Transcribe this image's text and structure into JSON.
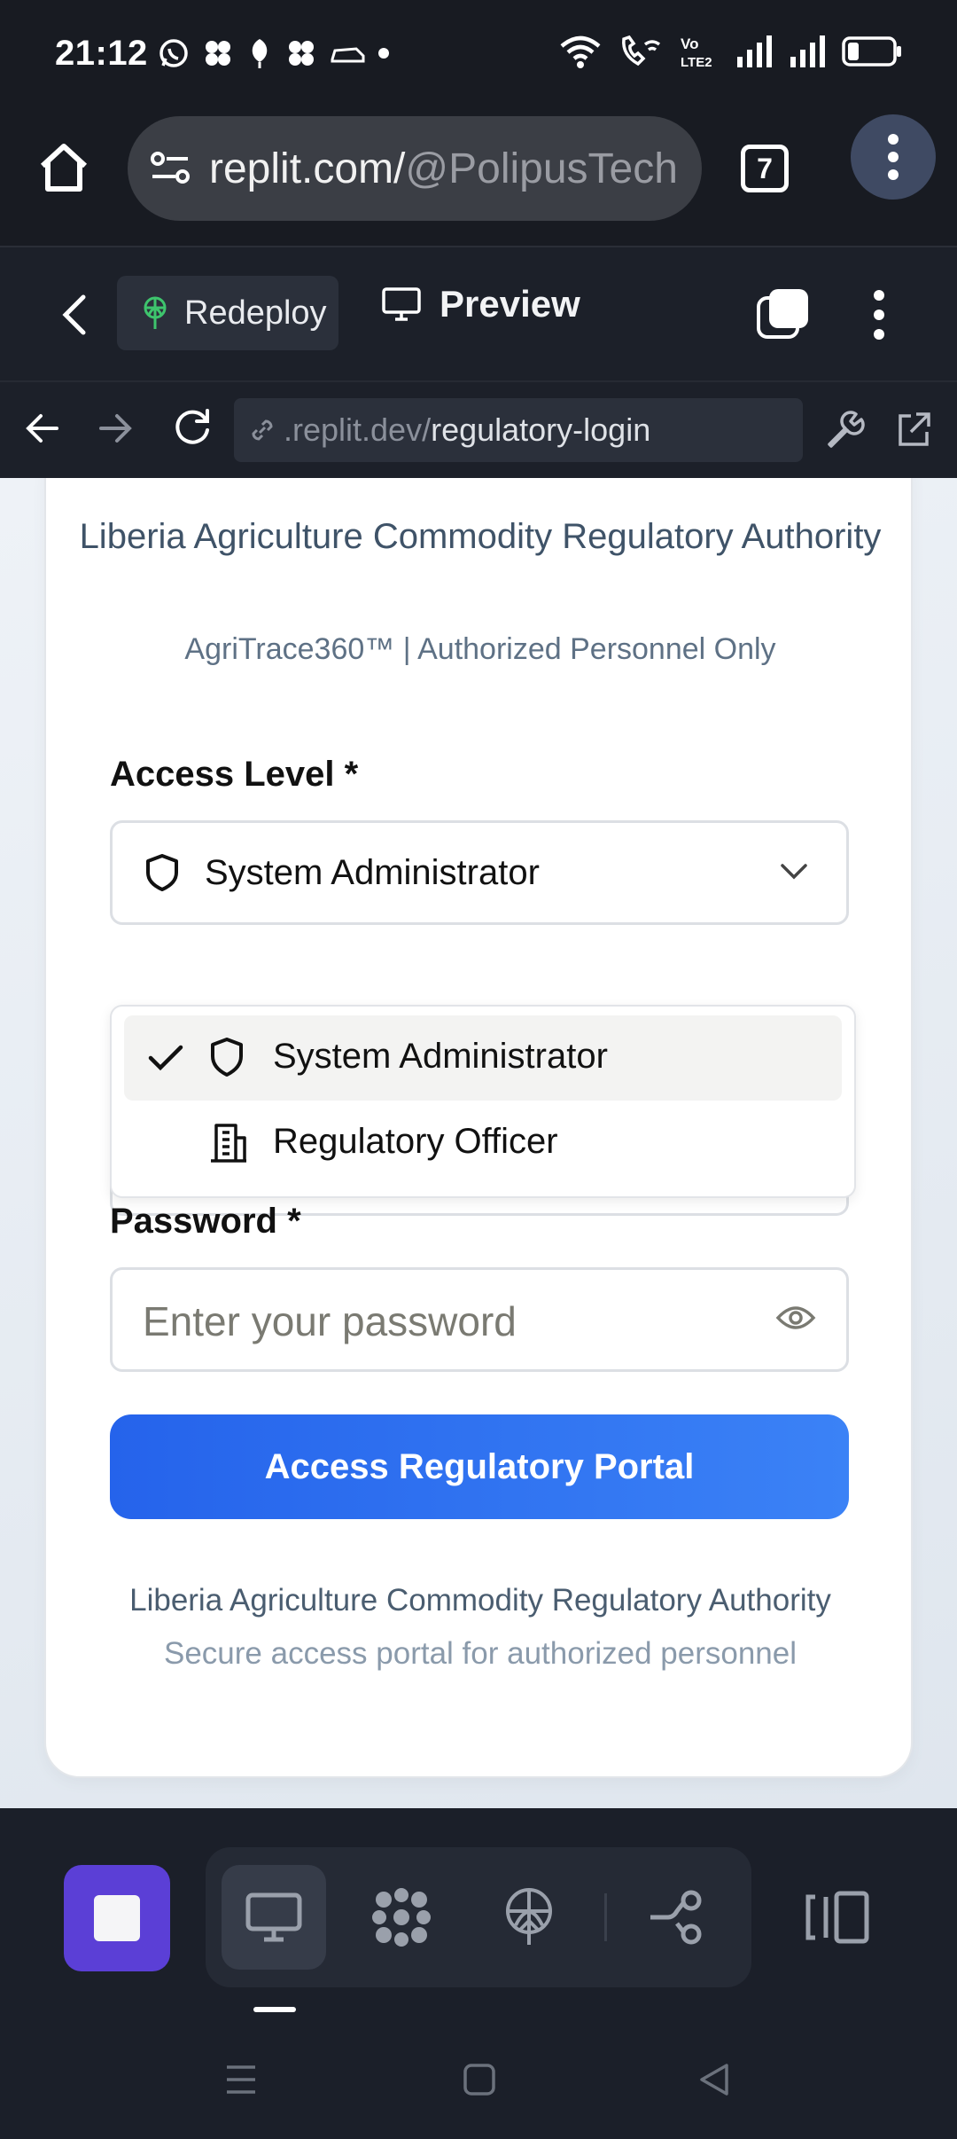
{
  "status_bar": {
    "time": "21:12"
  },
  "browser": {
    "url_host": "replit.com/",
    "url_path": "@PolipusTech",
    "tab_count": "7"
  },
  "replit": {
    "redeploy_label": "Redeploy",
    "preview_label": "Preview"
  },
  "address": {
    "host": ".replit.dev/",
    "path": "regulatory-login"
  },
  "page": {
    "org_title": "Liberia Agriculture Commodity Regulatory Authority",
    "org_subtitle": "AgriTrace360™ | Authorized Personnel Only",
    "access_label": "Access Level *",
    "access_selected": "System Administrator",
    "dropdown_options": [
      {
        "label": "System Administrator",
        "icon": "shield-icon",
        "selected": true
      },
      {
        "label": "Regulatory Officer",
        "icon": "building-icon",
        "selected": false
      }
    ],
    "password_label": "Password *",
    "password_placeholder": "Enter your password",
    "submit_label": "Access Regulatory Portal",
    "footer_line1": "Liberia Agriculture Commodity Regulatory Authority",
    "footer_line2": "Secure access portal for authorized personnel"
  },
  "colors": {
    "primary": "#2563eb",
    "stop_button": "#5b3fd6",
    "app_chrome": "#1c2029"
  }
}
